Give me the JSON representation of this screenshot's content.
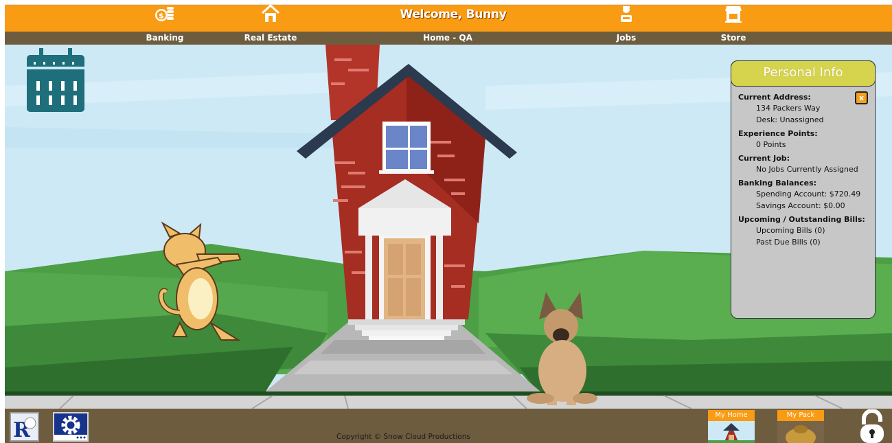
{
  "header": {
    "welcome": "Welcome, Bunny"
  },
  "nav": {
    "items": [
      {
        "label": "Banking",
        "icon": "coins-icon"
      },
      {
        "label": "Real Estate",
        "icon": "house-icon"
      },
      {
        "label": "Home - QA",
        "icon": ""
      },
      {
        "label": "Jobs",
        "icon": "worker-icon"
      },
      {
        "label": "Store",
        "icon": "storefront-icon"
      }
    ]
  },
  "personal_info": {
    "title": "Personal Info",
    "close_label": "x",
    "current_address_label": "Current Address",
    "address": "134 Packers Way",
    "desk": "Desk: Unassigned",
    "experience_label": "Experience Points",
    "points": "0 Points",
    "job_label": "Current Job",
    "job": "No Jobs Currently Assigned",
    "banking_label": "Banking Balances",
    "spending": "Spending Account: $720.49",
    "savings": "Savings Account: $0.00",
    "bills_label": "Upcoming / Outstanding Bills",
    "upcoming_bills": "Upcoming Bills (0)",
    "past_due_bills": "Past Due Bills (0)"
  },
  "footer": {
    "copyright": "Copyright © Snow Cloud Productions",
    "my_home": "My Home",
    "my_pack": "My Pack"
  },
  "colors": {
    "nav_orange": "#f99b13",
    "nav_brown": "#6e5c3f",
    "panel_header": "#d6d34c",
    "panel_body": "#c7c7c7",
    "calendar": "#1e6e7b"
  }
}
